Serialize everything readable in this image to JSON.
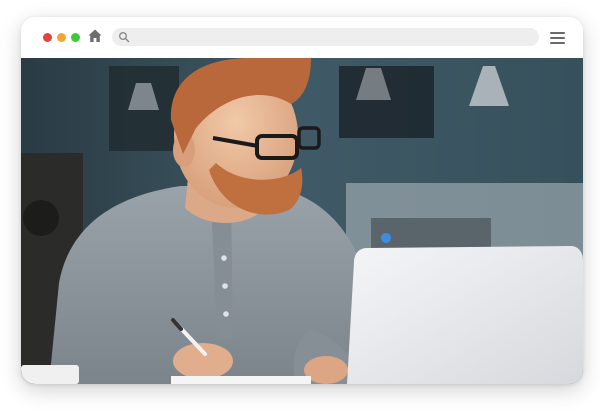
{
  "window": {
    "controls": {
      "close_color": "#e0443e",
      "minimize_color": "#f2a534",
      "maximize_color": "#3ec93b"
    },
    "home_icon": "home-icon",
    "menu_icon": "hamburger-menu-icon"
  },
  "address_bar": {
    "icon": "search-icon",
    "value": "",
    "placeholder": ""
  },
  "content": {
    "image_subject": "photo"
  },
  "colors": {
    "wall": "#3f5a66",
    "shirt": "#8e969e",
    "laptop": "#e6e8eb",
    "hair": "#b8683a"
  }
}
